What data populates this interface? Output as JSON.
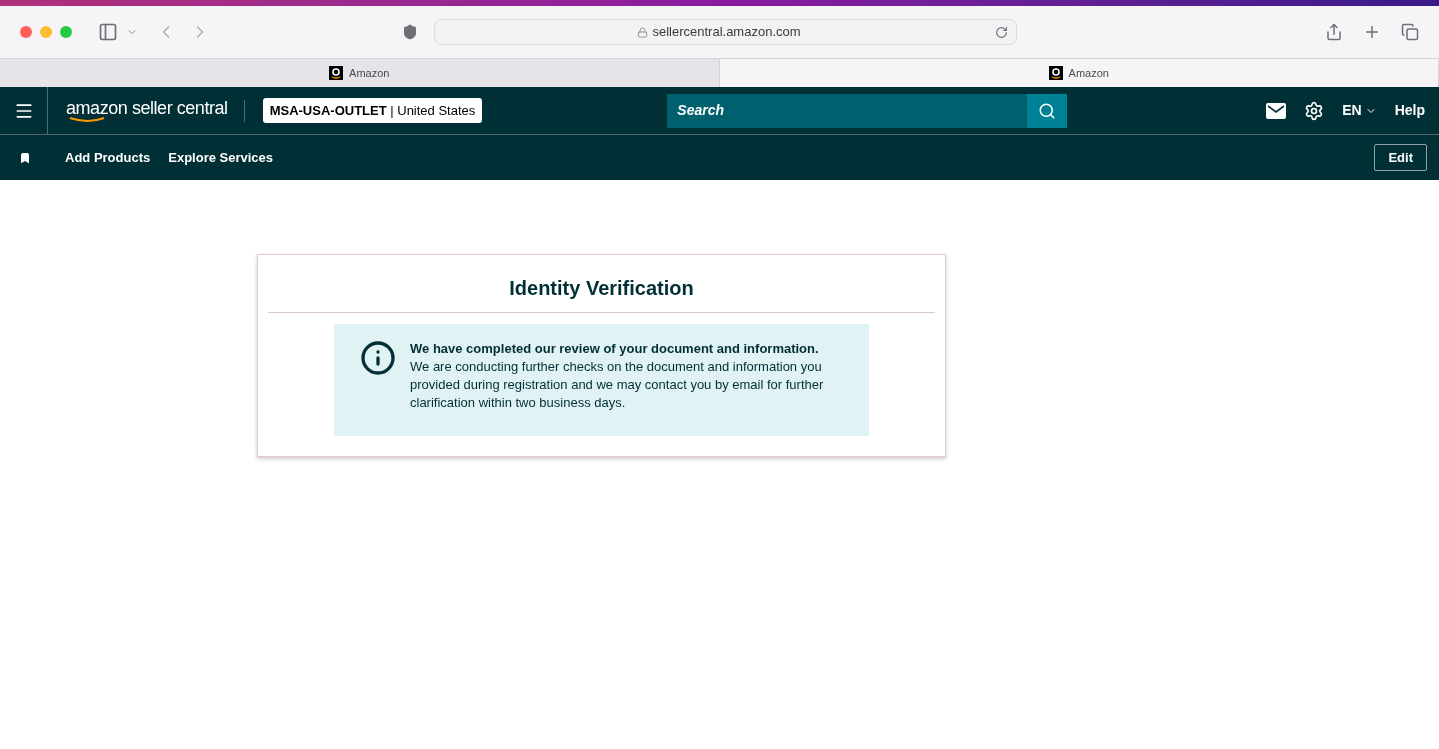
{
  "browser": {
    "url": "sellercentral.amazon.com",
    "tabs": [
      {
        "label": "Amazon",
        "selected": false
      },
      {
        "label": "Amazon",
        "selected": true
      }
    ]
  },
  "header": {
    "logo": "amazon seller central",
    "store": "**MSA-USA-OUTLET** | United States",
    "search": {
      "placeholder": "Search"
    },
    "language": "EN",
    "help": "Help"
  },
  "subnav": {
    "links": [
      "Add Products",
      "Explore Services"
    ],
    "edit": "Edit"
  },
  "card": {
    "title": "Identity Verification",
    "alert": {
      "heading": "We have completed our review of your document and information.",
      "body": "We are conducting further checks on the document and information you provided during registration and we may contact you by email for further clarification within two business days."
    }
  }
}
